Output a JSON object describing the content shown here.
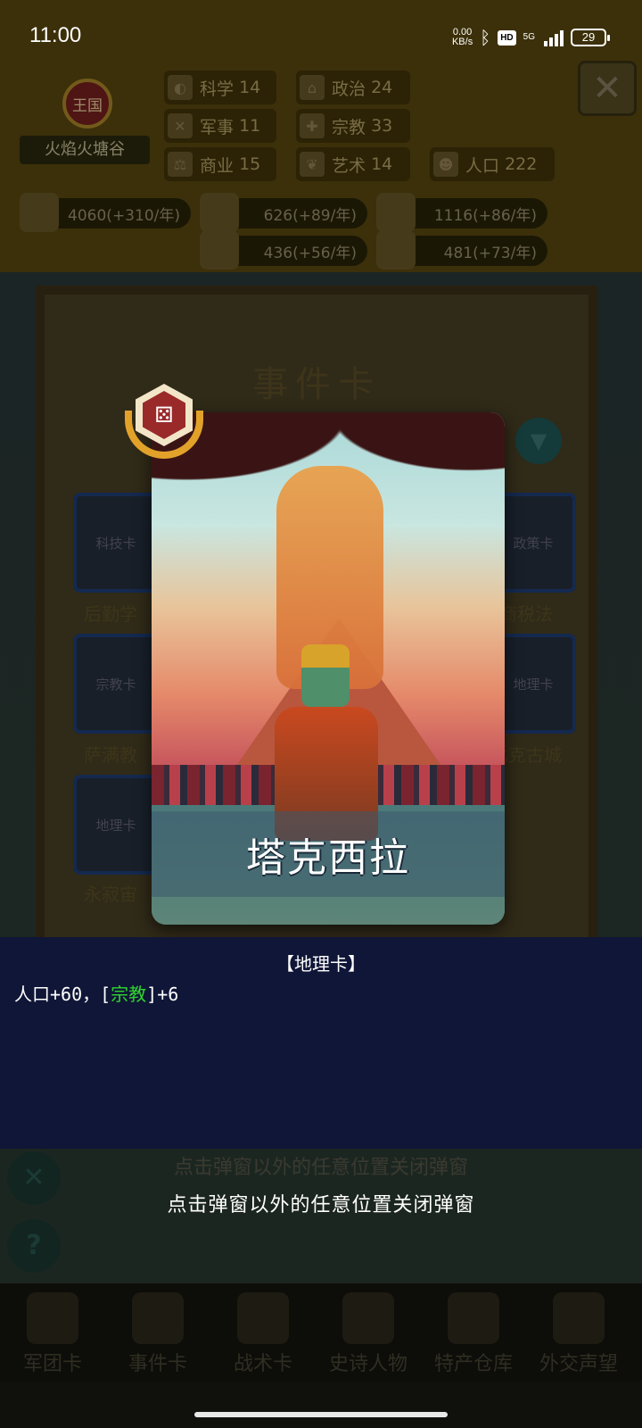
{
  "status_bar": {
    "time": "11:00",
    "net_speed": "0.00",
    "net_unit": "KB/s",
    "hd": "HD",
    "signal_label": "5G",
    "battery": "29"
  },
  "kingdom": {
    "rank": "王国",
    "name": "火焰火塘谷"
  },
  "stats": [
    {
      "icon": "science-icon",
      "label": "科学",
      "value": "14"
    },
    {
      "icon": "politics-icon",
      "label": "政治",
      "value": "24"
    },
    {
      "icon": "military-icon",
      "label": "军事",
      "value": "11"
    },
    {
      "icon": "religion-icon",
      "label": "宗教",
      "value": "33"
    },
    {
      "icon": "commerce-icon",
      "label": "商业",
      "value": "15"
    },
    {
      "icon": "art-icon",
      "label": "艺术",
      "value": "14"
    },
    {
      "icon": "population-icon",
      "label": "人口",
      "value": "222"
    }
  ],
  "resources": [
    {
      "icon": "gold-icon",
      "value": "4060(+310/年)"
    },
    {
      "icon": "wood-icon",
      "value": "626(+89/年)"
    },
    {
      "icon": "iron-icon",
      "value": "1116(+86/年)"
    },
    {
      "icon": "stone-icon",
      "value": "436(+56/年)"
    },
    {
      "icon": "food-icon",
      "value": "481(+73/年)"
    }
  ],
  "event_panel": {
    "title": "事件卡",
    "cards": [
      {
        "type": "科技卡",
        "label": "后勤学"
      },
      {
        "type": "政策卡",
        "label": "商税法"
      },
      {
        "type": "宗教卡",
        "label": "萨满教"
      },
      {
        "type": "地理卡",
        "label": "比克古城"
      },
      {
        "type": "地理卡",
        "label": "永寂宙"
      }
    ]
  },
  "modal": {
    "card_name": "塔克西拉",
    "card_type": "【地理卡】",
    "effect_prefix": "人口+60，[",
    "effect_tag": "宗教",
    "effect_suffix": "]+6",
    "close_hint": "点击弹窗以外的任意位置关闭弹窗",
    "colors": {
      "tag": "#2fd52f",
      "panel": "#101637"
    }
  },
  "bottom_nav": [
    {
      "label": "军团卡",
      "icon": "helmet-icon"
    },
    {
      "label": "事件卡",
      "icon": "scroll-icon"
    },
    {
      "label": "战术卡",
      "icon": "tactics-icon"
    },
    {
      "label": "史诗人物",
      "icon": "crown-icon"
    },
    {
      "label": "特产仓库",
      "icon": "chest-icon"
    },
    {
      "label": "外交声望",
      "icon": "letter-icon"
    }
  ],
  "side_buttons": {
    "sound": "mute-icon",
    "help": "?"
  }
}
